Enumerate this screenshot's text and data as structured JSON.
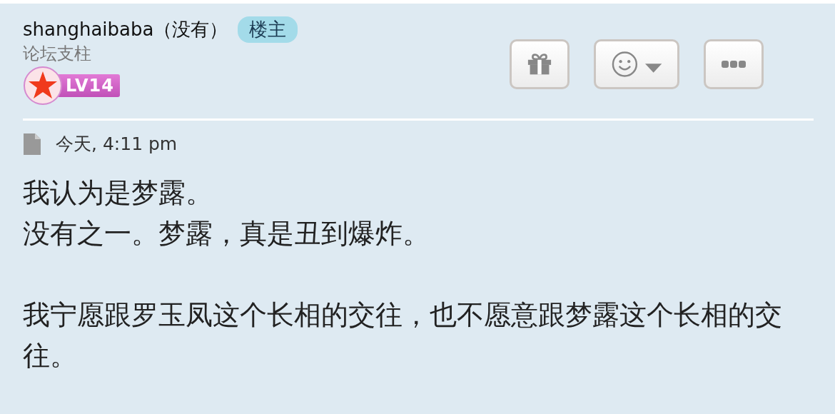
{
  "post": {
    "author": "shanghaibaba（没有）",
    "author_badge": "楼主",
    "user_title": "论坛支柱",
    "level_badge": "LV14",
    "timestamp": "今天, 4:11 pm",
    "paragraphs": [
      {
        "lines": [
          "我认为是梦露。",
          "没有之一。梦露，真是丑到爆炸。"
        ]
      },
      {
        "lines": [
          "我宁愿跟罗玉凤这个长相的交往，也不愿意跟梦露这个长相的交往。"
        ]
      }
    ]
  }
}
